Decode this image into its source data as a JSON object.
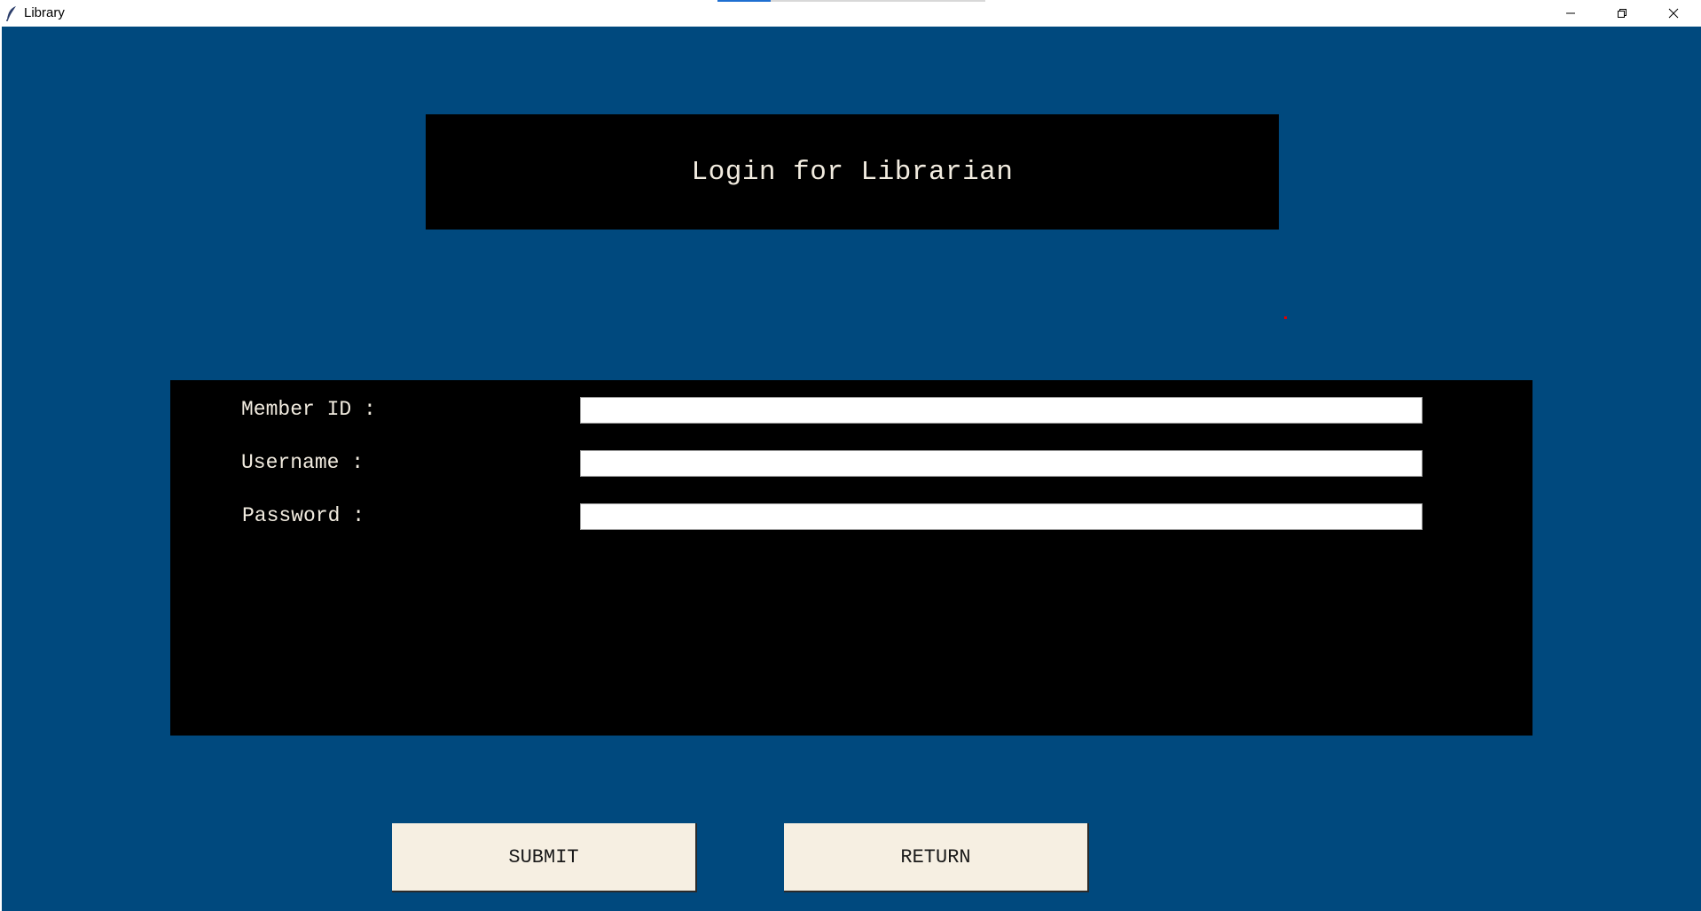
{
  "window": {
    "title": "Library",
    "icon": "feather-icon",
    "controls": [
      "minimize-icon",
      "restore-icon",
      "close-icon"
    ]
  },
  "header": {
    "title": "Login for Librarian"
  },
  "form": {
    "fields": [
      {
        "label": "Member ID :",
        "value": ""
      },
      {
        "label": "Username :",
        "value": ""
      },
      {
        "label": "Password :",
        "value": ""
      }
    ]
  },
  "actions": {
    "submit_label": "SUBMIT",
    "return_label": "RETURN"
  },
  "colors": {
    "background": "#00497e",
    "panel": "#000000",
    "text": "#f2ece0",
    "button": "#f6efe2"
  }
}
